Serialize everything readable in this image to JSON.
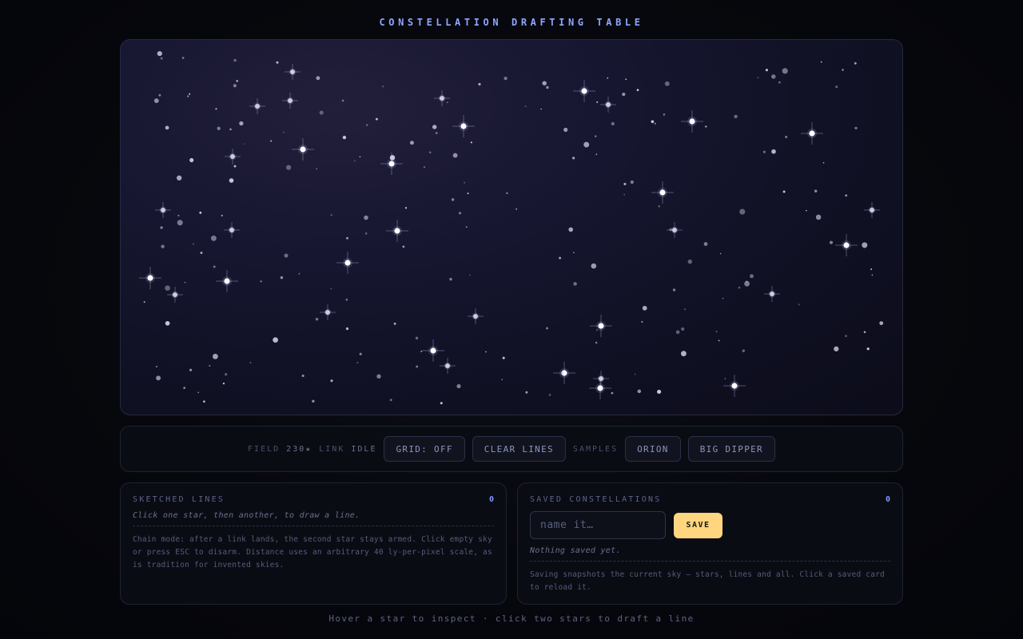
{
  "app": {
    "title": "CONSTELLATION DRAFTING TABLE"
  },
  "toolbar": {
    "field_label": "FIELD",
    "field_value": "230★",
    "link_label": "LINK",
    "link_value": "IDLE",
    "grid_button": "GRID: OFF",
    "clear_button": "CLEAR LINES",
    "samples_label": "SAMPLES",
    "orion_button": "ORION",
    "dipper_button": "BIG DIPPER"
  },
  "sketched": {
    "title": "SKETCHED LINES",
    "count": "0",
    "hint": "Click one star, then another, to draw a line.",
    "description": "Chain mode: after a link lands, the second star stays armed. Click empty sky or press ESC to disarm. Distance uses an arbitrary 40 ly-per-pixel scale, as is tradition for invented skies."
  },
  "saved": {
    "title": "SAVED CONSTELLATIONS",
    "count": "0",
    "input_placeholder": "name it…",
    "input_value": "",
    "save_button": "SAVE",
    "empty_text": "Nothing saved yet.",
    "description": "Saving snapshots the current sky — stars, lines and all. Click a saved card to reload it."
  },
  "footer": {
    "hint": "Hover a star to inspect · click two stars to draft a line"
  },
  "colors": {
    "accent": "#8ea6ff",
    "save_button": "#ffd580",
    "panel_border": "#262a3e"
  }
}
